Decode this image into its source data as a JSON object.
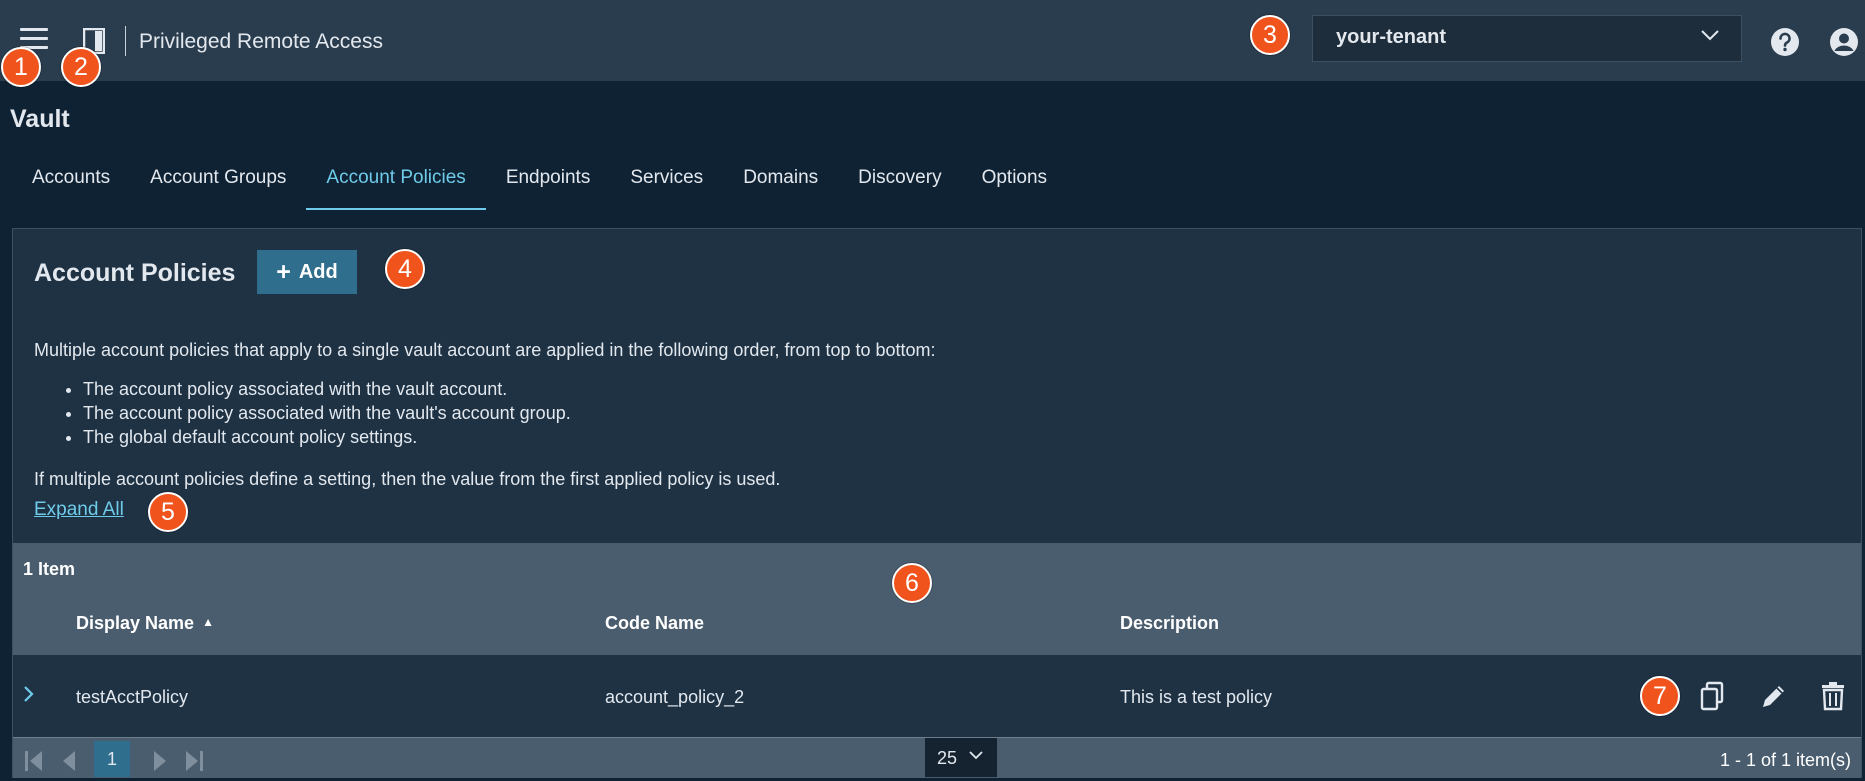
{
  "header": {
    "app_title": "Privileged Remote Access",
    "tenant": "your-tenant",
    "icons": {
      "menu": "hamburger-menu-icon",
      "app": "app-switcher-icon",
      "help": "help-icon",
      "user": "user-account-icon"
    }
  },
  "page": {
    "title": "Vault",
    "tabs": [
      {
        "label": "Accounts",
        "active": false
      },
      {
        "label": "Account Groups",
        "active": false
      },
      {
        "label": "Account Policies",
        "active": true
      },
      {
        "label": "Endpoints",
        "active": false
      },
      {
        "label": "Services",
        "active": false
      },
      {
        "label": "Domains",
        "active": false
      },
      {
        "label": "Discovery",
        "active": false
      },
      {
        "label": "Options",
        "active": false
      }
    ]
  },
  "panel": {
    "title": "Account Policies",
    "add_label": "Add",
    "description": "Multiple account policies that apply to a single vault account are applied in the following order, from top to bottom:",
    "order": [
      "The account policy associated with the vault account.",
      "The account policy associated with the vault's account group.",
      "The global default account policy settings."
    ],
    "note": "If multiple account policies define a setting, then the value from the first applied policy is used.",
    "expand_all": "Expand All"
  },
  "grid": {
    "item_count": "1 Item",
    "columns": [
      "Display Name",
      "Code Name",
      "Description"
    ],
    "sort_indicator": "▲",
    "rows": [
      {
        "display_name": "testAcctPolicy",
        "code_name": "account_policy_2",
        "description": "This is a test policy"
      }
    ],
    "pager": {
      "current_page": "1",
      "page_size": "25",
      "info": "1 - 1 of 1 item(s)"
    }
  },
  "callouts": [
    "1",
    "2",
    "3",
    "4",
    "5",
    "6",
    "7"
  ],
  "colors": {
    "topbar": "#2a3d4e",
    "background": "#0f2233",
    "panel": "#1e3244",
    "accent": "#6ecbe9",
    "button": "#2f6e8c",
    "callout": "#f0531c"
  }
}
